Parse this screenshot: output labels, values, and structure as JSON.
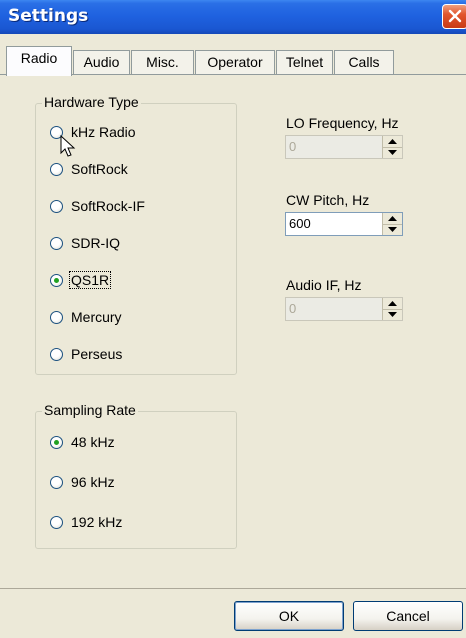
{
  "window": {
    "title": "Settings"
  },
  "tabs": [
    {
      "label": "Radio",
      "active": true
    },
    {
      "label": "Audio",
      "active": false
    },
    {
      "label": "Misc.",
      "active": false
    },
    {
      "label": "Operator",
      "active": false
    },
    {
      "label": "Telnet",
      "active": false
    },
    {
      "label": "Calls",
      "active": false
    }
  ],
  "hardware": {
    "title": "Hardware Type",
    "options": [
      {
        "label": "kHz Radio",
        "checked": false
      },
      {
        "label": "SoftRock",
        "checked": false
      },
      {
        "label": "SoftRock-IF",
        "checked": false
      },
      {
        "label": "SDR-IQ",
        "checked": false
      },
      {
        "label": "QS1R",
        "checked": true
      },
      {
        "label": "Mercury",
        "checked": false
      },
      {
        "label": "Perseus",
        "checked": false
      }
    ]
  },
  "sampling": {
    "title": "Sampling Rate",
    "options": [
      {
        "label": "48 kHz",
        "checked": true
      },
      {
        "label": "96 kHz",
        "checked": false
      },
      {
        "label": "192 kHz",
        "checked": false
      }
    ]
  },
  "fields": {
    "lo_frequency": {
      "label": "LO Frequency, Hz",
      "value": "0",
      "enabled": false
    },
    "cw_pitch": {
      "label": "CW Pitch, Hz",
      "value": "600",
      "enabled": true
    },
    "audio_if": {
      "label": "Audio IF, Hz",
      "value": "0",
      "enabled": false
    }
  },
  "buttons": {
    "ok": "OK",
    "cancel": "Cancel"
  }
}
